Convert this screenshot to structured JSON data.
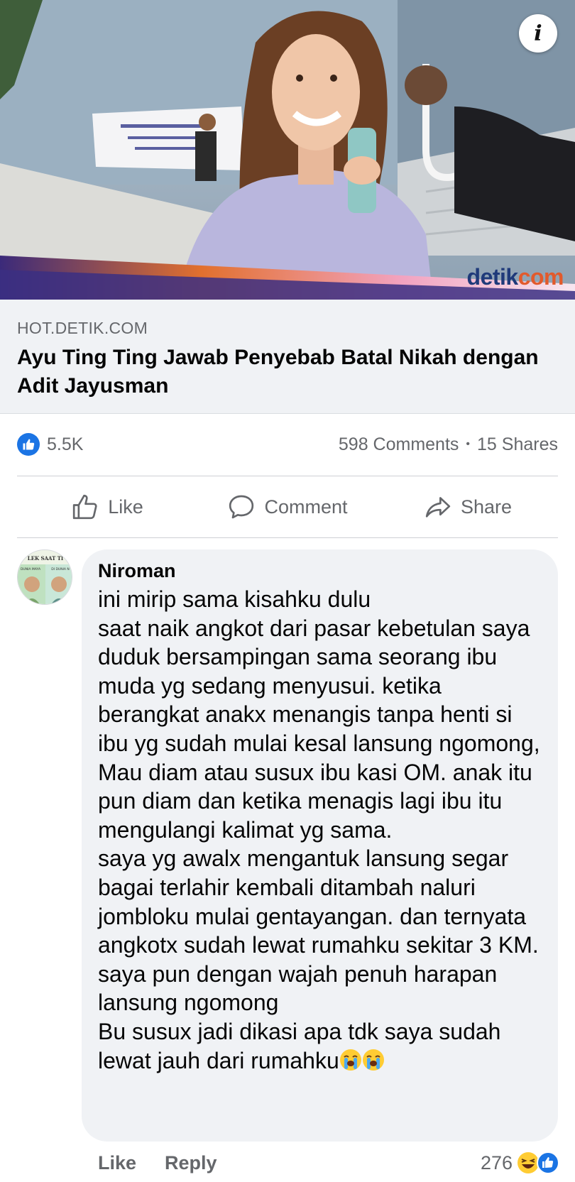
{
  "post": {
    "image_brand_part1": "detik",
    "image_brand_part2": "com",
    "info_button_glyph": "i"
  },
  "link_preview": {
    "domain": "HOT.DETIK.COM",
    "title": "Ayu Ting Ting Jawab Penyebab Batal Nikah dengan Adit Jayusman"
  },
  "stats": {
    "reaction_icon": "like-icon",
    "reactions_count": "5.5K",
    "comments": "598 Comments",
    "separator": "•",
    "shares": "15 Shares"
  },
  "actions": {
    "like": "Like",
    "comment": "Comment",
    "share": "Share"
  },
  "comment": {
    "author": "Niroman",
    "avatar_caption_left": "DUNIA MAYA",
    "avatar_caption_right": "DI DUNIA N",
    "avatar_caption_top": "LEK SAAT TI",
    "text": "ini mirip sama kisahku dulu\nsaat naik angkot dari pasar kebetulan saya duduk bersampingan sama seorang ibu muda yg sedang menyusui. ketika berangkat anakx menangis tanpa henti si ibu yg sudah mulai kesal lansung ngomong, Mau diam atau susux ibu kasi OM. anak itu pun diam dan ketika menagis lagi ibu itu mengulangi kalimat yg sama.\nsaya yg awalx mengantuk lansung segar bagai terlahir kembali ditambah naluri jombloku mulai gentayangan. dan ternyata angkotx sudah lewat rumahku sekitar 3 KM.\nsaya pun dengan wajah penuh harapan lansung ngomong\nBu susux jadi dikasi apa tdk saya sudah lewat jauh dari rumahku",
    "trailing_emoji": [
      "loudly-crying-face-emoji",
      "loudly-crying-face-emoji"
    ],
    "like_label": "Like",
    "reply_label": "Reply",
    "reaction_count": "276",
    "reaction_icons": [
      "haha-icon",
      "like-icon"
    ]
  },
  "colors": {
    "facebook_blue": "#1b74e4",
    "secondary_text": "#65676b",
    "bubble_bg": "#f0f2f5",
    "brand_dark": "#1f3a7a",
    "brand_orange": "#e25a2c"
  }
}
